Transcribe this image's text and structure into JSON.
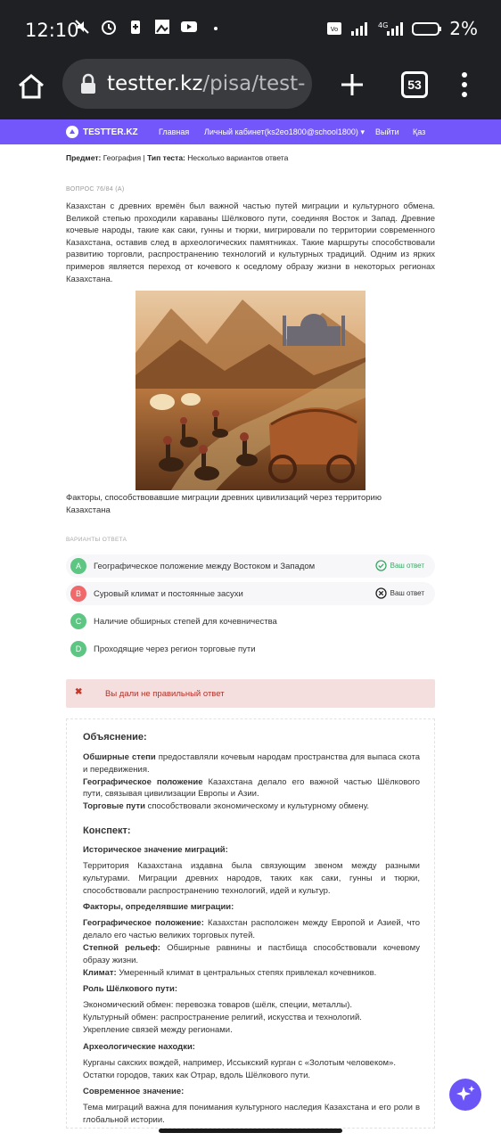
{
  "status_bar": {
    "time": "12:10",
    "battery": "2%",
    "network": "4G"
  },
  "browser": {
    "url_host": "testter.kz",
    "url_path": "/pisa/test-re",
    "tab_count": "53"
  },
  "navbar": {
    "brand": "TESTTER.KZ",
    "items": [
      "Главная",
      "Личный кабинет(ks2eo1800@school1800)",
      "Выйти",
      "Қаз"
    ]
  },
  "meta": {
    "subject_label": "Предмет:",
    "subject": "География",
    "separator": "|",
    "type_label": "Тип теста:",
    "type": "Несколько вариантов ответа"
  },
  "question": {
    "number": "ВОПРОС 76/84",
    "extra": "(А)",
    "text": "Казахстан с древних времён был важной частью путей миграции и культурного обмена. Великой степью проходили караваны Шёлкового пути, соединяя Восток и Запад. Древние кочевые народы, такие как саки, гунны и тюрки, мигрировали по территории современного Казахстана, оставив след в археологических памятниках. Такие маршруты способствовали развитию торговли, распространению технологий и культурных традиций. Одним из ярких примеров является переход от кочевого к оседлому образу жизни в некоторых регионах Казахстана.",
    "caption": "Факторы, способствовавшие миграции древних цивилизаций через территорию Казахстана"
  },
  "answers_label": "ВАРИАНТЫ ОТВЕТА",
  "answers": [
    {
      "letter": "A",
      "text": "Географическое положение между Востоком и Западом",
      "tag": "Ваш ответ",
      "color": "#5cc682"
    },
    {
      "letter": "B",
      "text": "Суровый климат и постоянные засухи",
      "tag": "Ваш ответ",
      "color": "#f0686a"
    },
    {
      "letter": "C",
      "text": "Наличие обширных степей для кочевничества",
      "tag": "",
      "color": "#5cc682"
    },
    {
      "letter": "D",
      "text": "Проходящие через регион торговые пути",
      "tag": "",
      "color": "#5cc682"
    }
  ],
  "error": {
    "text": "Вы дали не правильный ответ"
  },
  "explanation": {
    "title": "Объяснение:",
    "items": [
      {
        "bold": "Обширные степи",
        "text": " предоставляли кочевым народам пространства для выпаса скота и передвижения."
      },
      {
        "bold": "Географическое положение",
        "text": " Казахстана делало его важной частью Шёлкового пути, связывая цивилизации Европы и Азии."
      },
      {
        "bold": "Торговые пути",
        "text": " способствовали экономическому и культурному обмену."
      }
    ],
    "konspekt_title": "Конспект:",
    "s1_title": "Историческое значение миграций:",
    "s1_text": "Территория Казахстана издавна была связующим звеном между разными культурами. Миграции древних народов, таких как саки, гунны и тюрки, способствовали распространению технологий, идей и культур.",
    "s2_title": "Факторы, определявшие миграции:",
    "s2_items": [
      {
        "bold": "Географическое положение:",
        "text": " Казахстан расположен между Европой и Азией, что делало его частью великих торговых путей."
      },
      {
        "bold": "Степной рельеф:",
        "text": " Обширные равнины и пастбища способствовали кочевому образу жизни."
      },
      {
        "bold": "Климат:",
        "text": " Умеренный климат в центральных степях привлекал кочевников."
      }
    ],
    "s3_title": "Роль Шёлкового пути:",
    "s3_lines": [
      "Экономический обмен: перевозка товаров (шёлк, специи, металлы).",
      "Культурный обмен: распространение религий, искусства и технологий.",
      "Укрепление связей между регионами."
    ],
    "s4_title": "Археологические находки:",
    "s4_lines": [
      "Курганы сакских вождей, например, Иссыкский курган с «Золотым человеком».",
      "Остатки городов, таких как Отрар, вдоль Шёлкового пути."
    ],
    "s5_title": "Современное значение:",
    "s5_text": "Тема миграций важна для понимания культурного наследия Казахстана и его роли в глобальной истории."
  }
}
